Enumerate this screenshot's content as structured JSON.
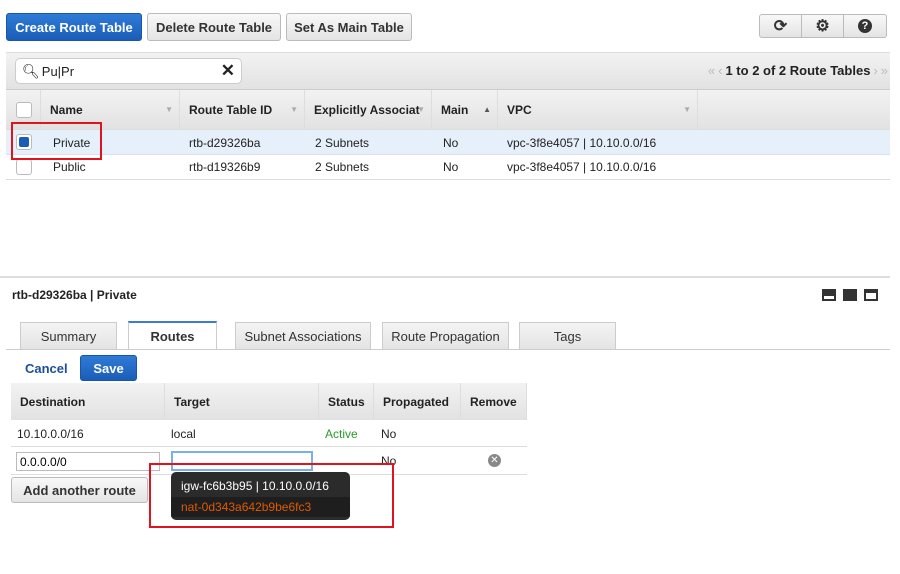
{
  "toolbar": {
    "create": "Create Route Table",
    "delete": "Delete Route Table",
    "set_main": "Set As Main Table",
    "icons": [
      "refresh-icon",
      "gear-icon",
      "help-icon"
    ]
  },
  "filter": {
    "value": "Pu|Pr",
    "pagination": "1 to 2 of 2 Route Tables"
  },
  "table": {
    "columns": [
      "Name",
      "Route Table ID",
      "Explicitly Associat",
      "Main",
      "VPC"
    ],
    "rows": [
      {
        "selected": true,
        "name": "Private",
        "id": "rtb-d29326ba",
        "assoc": "2 Subnets",
        "main": "No",
        "vpc": "vpc-3f8e4057 | 10.10.0.0/16"
      },
      {
        "selected": false,
        "name": "Public",
        "id": "rtb-d19326b9",
        "assoc": "2 Subnets",
        "main": "No",
        "vpc": "vpc-3f8e4057 | 10.10.0.0/16"
      }
    ]
  },
  "detail": {
    "title": "rtb-d29326ba | Private",
    "tabs": [
      "Summary",
      "Routes",
      "Subnet Associations",
      "Route Propagation",
      "Tags"
    ],
    "active_tab": "Routes",
    "cancel": "Cancel",
    "save": "Save",
    "routes_columns": [
      "Destination",
      "Target",
      "Status",
      "Propagated",
      "Remove"
    ],
    "routes": [
      {
        "destination": "10.10.0.0/16",
        "target": "local",
        "status": "Active",
        "propagated": "No"
      },
      {
        "destination": "0.0.0.0/0",
        "target": "",
        "propagated": "No"
      }
    ],
    "add_route": "Add another route",
    "dropdown": [
      "igw-fc6b3b95 | 10.10.0.0/16",
      "nat-0d343a642b9be6fc3"
    ]
  },
  "colors": {
    "accent": "#1a5db8",
    "active": "#2a9a2a",
    "highlight": "#e05a00",
    "selection_box": "#e0141e"
  }
}
